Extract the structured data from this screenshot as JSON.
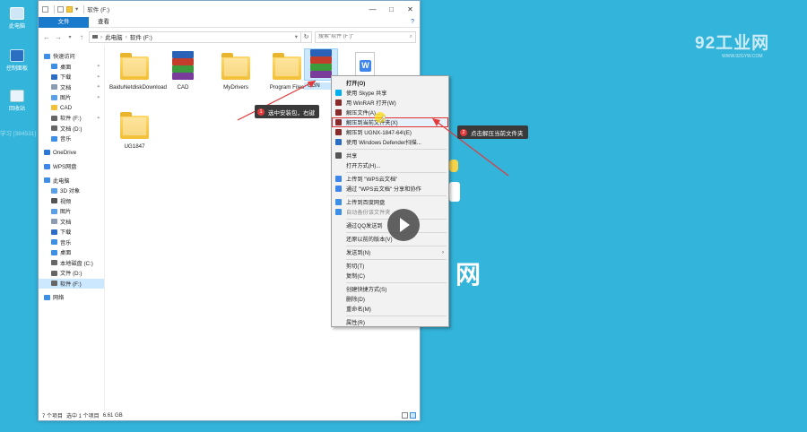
{
  "desktop": {
    "icons": [
      {
        "label": "此电脑",
        "icon": "computer-icon"
      },
      {
        "label": "控制面板",
        "icon": "control-panel-icon"
      },
      {
        "label": "回收站",
        "icon": "recycle-bin-icon"
      }
    ],
    "logo_text": "92工业网",
    "logo_sub": "WWW.92GYW.COM",
    "side_text": "网",
    "watermark": "学习 [384531] 2020-10-17"
  },
  "window": {
    "title": "软件 (F:)",
    "controls": [
      "—",
      "□",
      "✕"
    ],
    "ribbon_tabs": [
      "文件",
      "主页",
      "共享",
      "查看"
    ],
    "help": "?",
    "address": [
      "此电脑",
      "软件 (F:)"
    ],
    "search_placeholder": "搜索\"软件 (F:)\""
  },
  "navpane": [
    {
      "label": "快速访问",
      "level": 0,
      "color": "#3d8ee6"
    },
    {
      "label": "桌面",
      "level": 1,
      "color": "#3d8ee6",
      "pin": "✦"
    },
    {
      "label": "下载",
      "level": 1,
      "color": "#2b6cc4",
      "pin": "✦"
    },
    {
      "label": "文档",
      "level": 1,
      "color": "#8b9bb0",
      "pin": "✦"
    },
    {
      "label": "图片",
      "level": 1,
      "color": "#5aa0e6",
      "pin": "✦"
    },
    {
      "label": "CAD",
      "level": 1,
      "color": "#f2c038"
    },
    {
      "label": "软件 (F:)",
      "level": 1,
      "color": "#666",
      "pin": "✦"
    },
    {
      "label": "文档 (D:)",
      "level": 1,
      "color": "#666"
    },
    {
      "label": "音乐",
      "level": 1,
      "color": "#3d8ee6"
    },
    {
      "label": "OneDrive",
      "level": 0,
      "color": "#2b78d6",
      "gap": true
    },
    {
      "label": "WPS网盘",
      "level": 0,
      "color": "#3f86ec",
      "gap": true
    },
    {
      "label": "此电脑",
      "level": 0,
      "color": "#3d8ee6",
      "gap": true
    },
    {
      "label": "3D 对象",
      "level": 1,
      "color": "#5aa0e6"
    },
    {
      "label": "视频",
      "level": 1,
      "color": "#555"
    },
    {
      "label": "图片",
      "level": 1,
      "color": "#5aa0e6"
    },
    {
      "label": "文档",
      "level": 1,
      "color": "#8b9bb0"
    },
    {
      "label": "下载",
      "level": 1,
      "color": "#2b6cc4"
    },
    {
      "label": "音乐",
      "level": 1,
      "color": "#3d8ee6"
    },
    {
      "label": "桌面",
      "level": 1,
      "color": "#3d8ee6"
    },
    {
      "label": "本地磁盘 (C:)",
      "level": 1,
      "color": "#666"
    },
    {
      "label": "文件 (D:)",
      "level": 1,
      "color": "#666"
    },
    {
      "label": "软件 (F:)",
      "level": 1,
      "color": "#666",
      "selected": true
    },
    {
      "label": "网络",
      "level": 0,
      "color": "#3d8ee6",
      "gap": true
    }
  ],
  "files": [
    {
      "name": "BaiduNetdiskDownload",
      "kind": "folder"
    },
    {
      "name": "CAD",
      "kind": "rar"
    },
    {
      "name": "MyDrivers",
      "kind": "folder"
    },
    {
      "name": "Program Files",
      "kind": "folder"
    },
    {
      "name": "UGN",
      "kind": "rar",
      "selected": true
    },
    {
      "name": "",
      "kind": "wps"
    },
    {
      "name": "UG1847",
      "kind": "folder"
    }
  ],
  "status": {
    "count": "7 个项目",
    "selected": "选中 1 个项目",
    "size": "6.61 GB"
  },
  "context_menu": [
    {
      "label": "打开(O)",
      "bold": true
    },
    {
      "label": "使用 Skype 共享",
      "icon": "#00aff0"
    },
    {
      "label": "用 WinRAR 打开(W)",
      "icon": "#8a2b2b"
    },
    {
      "label": "解压文件(A)...",
      "icon": "#8a2b2b"
    },
    {
      "label": "解压到当前文件夹(X)",
      "icon": "#8a2b2b",
      "highlight": true
    },
    {
      "label": "解压到 UGNX-1847-64\\(E)",
      "icon": "#8a2b2b"
    },
    {
      "label": "使用 Windows Defender扫描...",
      "icon": "#2b6cc4"
    },
    {
      "sep": true
    },
    {
      "label": "共享",
      "icon": "#555"
    },
    {
      "label": "打开方式(H)..."
    },
    {
      "sep": true
    },
    {
      "label": "上传到 \"WPS云文档\"",
      "icon": "#3f86ec"
    },
    {
      "label": "通过 \"WPS云文档\" 分享和协作",
      "icon": "#3f86ec"
    },
    {
      "sep": true
    },
    {
      "label": "上传到百度网盘",
      "icon": "#3d8ee6"
    },
    {
      "label": "自动备份该文件夹",
      "icon": "#3d8ee6",
      "dim": true
    },
    {
      "sep": true
    },
    {
      "label": "通过QQ发送到"
    },
    {
      "sep": true
    },
    {
      "label": "还原以前的版本(V)"
    },
    {
      "sep": true
    },
    {
      "label": "发送到(N)",
      "submenu": true
    },
    {
      "sep": true
    },
    {
      "label": "剪切(T)"
    },
    {
      "label": "复制(C)"
    },
    {
      "sep": true
    },
    {
      "label": "创建快捷方式(S)"
    },
    {
      "label": "删除(D)"
    },
    {
      "label": "重命名(M)"
    },
    {
      "sep": true
    },
    {
      "label": "属性(R)"
    }
  ],
  "annotations": [
    {
      "num": "1",
      "text": "选中安装包，右键"
    },
    {
      "num": "2",
      "text": "点击解压当前文件夹"
    }
  ],
  "colors": {
    "accent": "#e23a3a",
    "file_tab": "#1979ca",
    "desktop": "#33b4da"
  }
}
